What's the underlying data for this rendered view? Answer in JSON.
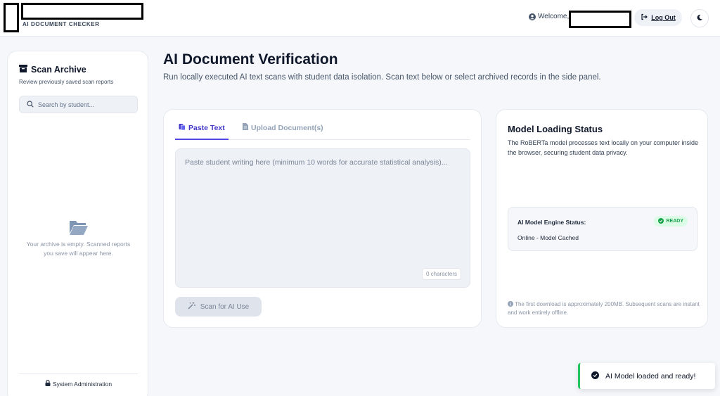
{
  "header": {
    "brand_subtitle": "AI DOCUMENT CHECKER",
    "welcome_text": "Welcome,",
    "logout_label": "Log Out",
    "icons": {
      "user": "user-circle-icon",
      "logout": "logout-icon",
      "theme": "moon-icon"
    }
  },
  "sidebar": {
    "title": "Scan Archive",
    "subtitle": "Review previously saved scan reports",
    "search_placeholder": "Search by student...",
    "empty_text": "Your archive is empty. Scanned reports you save will appear here.",
    "admin_label": "System Administration",
    "icons": {
      "title": "archive-icon",
      "search": "search-icon",
      "empty": "folder-open-icon",
      "admin": "lock-icon"
    }
  },
  "main": {
    "title": "AI Document Verification",
    "subtitle": "Run locally executed AI text scans with student data isolation. Scan text below or select archived records in the side panel.",
    "tabs": [
      {
        "label": "Paste Text",
        "active": true
      },
      {
        "label": "Upload Document(s)",
        "active": false
      }
    ],
    "textarea_placeholder": "Paste student writing here (minimum 10 words for accurate statistical analysis)...",
    "char_count": "0 characters",
    "scan_button": "Scan for AI Use"
  },
  "model": {
    "title": "Model Loading Status",
    "description": "The RoBERTa model processes text locally on your computer inside the browser, securing student data privacy.",
    "engine_label": "AI Model Engine Status:",
    "status_badge": "READY",
    "status_text": "Online - Model Cached",
    "download_note": "The first download is approximately 200MB. Subsequent scans are instant and work entirely offline."
  },
  "toast": {
    "message": "AI Model loaded and ready!"
  },
  "colors": {
    "accent": "#4f46e5",
    "success": "#22c55e",
    "background": "#f5f7fa"
  }
}
